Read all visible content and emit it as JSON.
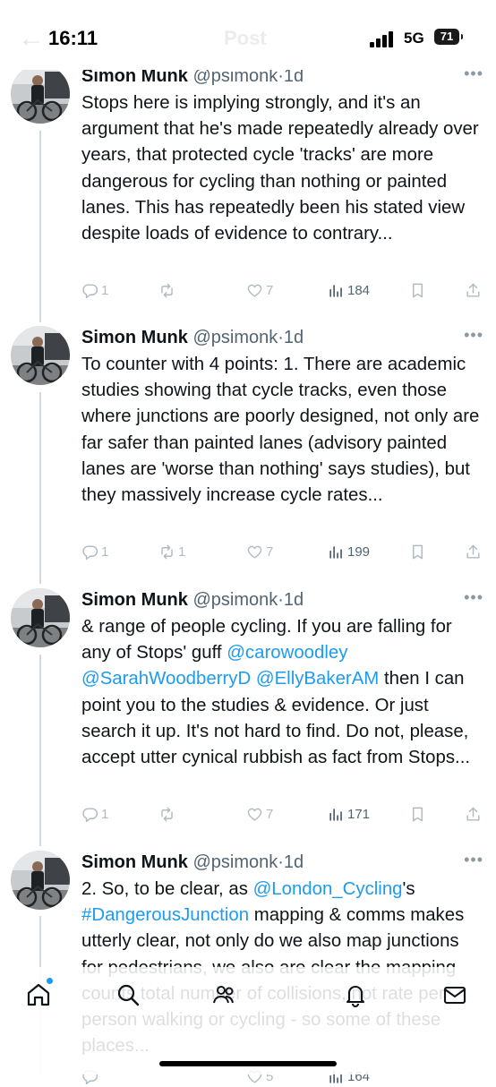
{
  "status_bar": {
    "time": "16:11",
    "network": "5G",
    "battery": "71",
    "ghost_back": "←",
    "ghost_title": "Post"
  },
  "thread": [
    {
      "author": "Simon Munk",
      "handle": "@psimonk",
      "time": "1d",
      "text": "Stops here is implying strongly, and it's an argument that he's made repeatedly already over years, that protected cycle 'tracks' are more dangerous for cycling than nothing or painted lanes. This has repeatedly been his stated view despite loads of evidence to contrary...",
      "replies": "1",
      "reposts": "",
      "likes": "7",
      "views": "184"
    },
    {
      "author": "Simon Munk",
      "handle": "@psimonk",
      "time": "1d",
      "text": "To counter with 4 points: 1. There are academic studies showing that cycle tracks, even those where junctions are poorly designed, not only are far safer than painted lanes (advisory painted lanes are 'worse than nothing' says studies), but they massively increase cycle rates...",
      "replies": "1",
      "reposts": "1",
      "likes": "7",
      "views": "199"
    },
    {
      "author": "Simon Munk",
      "handle": "@psimonk",
      "time": "1d",
      "text_parts": {
        "t1": "& range of people cycling. If you are falling for any of Stops' guff ",
        "m1": "@carowoodley",
        "m2": "@SarahWoodberryD",
        "m3": "@EllyBakerAM",
        "t2": " then I can point you to the studies & evidence. Or just search it up. It's not hard to find. Do not, please, accept utter cynical rubbish as fact from Stops..."
      },
      "replies": "1",
      "reposts": "",
      "likes": "7",
      "views": "171"
    },
    {
      "author": "Simon Munk",
      "handle": "@psimonk",
      "time": "1d",
      "text_parts": {
        "t1": "2. So, to be clear, as ",
        "m1": "@London_Cycling",
        "t2": "'s ",
        "h1": "#DangerousJunction",
        "t3": " mapping & comms makes utterly clear, not only do we also map junctions for pedestrians, we also are clear the mapping counts total number of collisions, not rate per person walking or cycling - so some of these places..."
      },
      "replies": "",
      "reposts": "",
      "likes": "5",
      "views": "164"
    }
  ],
  "colors": {
    "link": "#1d9bf0",
    "text": "#0f1419",
    "muted": "#536471",
    "thread_line": "#cfd9de"
  },
  "tab_bar": {
    "icons": [
      "home-icon",
      "search-icon",
      "communities-icon",
      "notifications-icon",
      "messages-icon"
    ]
  }
}
